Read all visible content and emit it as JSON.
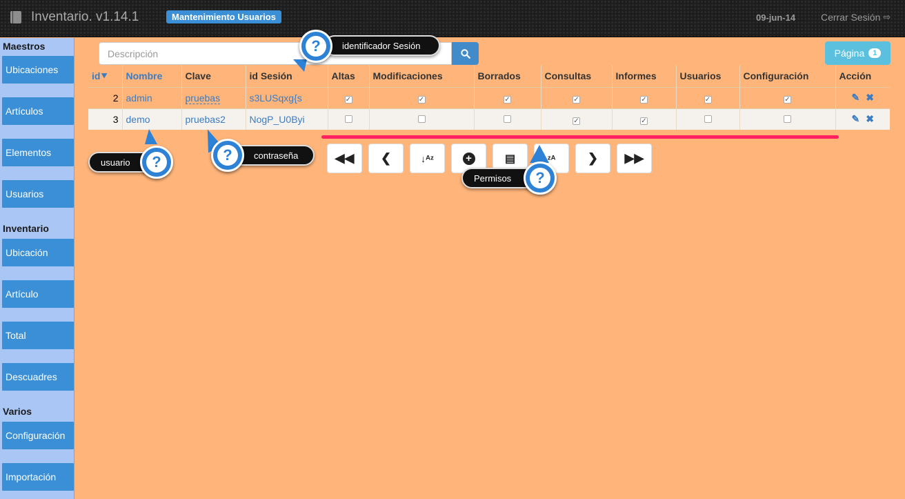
{
  "header": {
    "app_title": "Inventario. v1.14.1",
    "section_badge": "Mantenimiento Usuarios",
    "date": "09-jun-14",
    "logout_label": "Cerrar Sesión"
  },
  "sidebar": {
    "sections": [
      {
        "title": "Maestros",
        "items": [
          "Ubicaciones",
          "Artículos",
          "Elementos",
          "Usuarios"
        ]
      },
      {
        "title": "Inventario",
        "items": [
          "Ubicación",
          "Artículo",
          "Total",
          "Descuadres"
        ]
      },
      {
        "title": "Varios",
        "items": [
          "Configuración",
          "Importación"
        ]
      }
    ]
  },
  "search": {
    "placeholder": "Descripción"
  },
  "pager": {
    "label": "Página",
    "current": "1"
  },
  "table": {
    "columns": [
      "id",
      "Nombre",
      "Clave",
      "id Sesión",
      "Altas",
      "Modificaciones",
      "Borrados",
      "Consultas",
      "Informes",
      "Usuarios",
      "Configuración",
      "Acción"
    ],
    "rows": [
      {
        "id": "2",
        "nombre": "admin",
        "clave": "pruebas",
        "sesion": "s3LUSqxg{s",
        "perms": [
          true,
          true,
          true,
          true,
          true,
          true,
          true
        ]
      },
      {
        "id": "3",
        "nombre": "demo",
        "clave": "pruebas2",
        "sesion": "NogP_U0Byi",
        "perms": [
          false,
          false,
          false,
          true,
          true,
          false,
          false
        ]
      }
    ]
  },
  "callouts": {
    "sesion": "identificador Sesión",
    "usuario": "usuario",
    "contrasena": "contraseña",
    "permisos": "Permisos",
    "question_mark": "?"
  },
  "colors": {
    "accent": "#3a8fd6",
    "background": "#ffb57a",
    "sidebar": "#a9c6f5",
    "highlight_line": "#ff2060"
  }
}
